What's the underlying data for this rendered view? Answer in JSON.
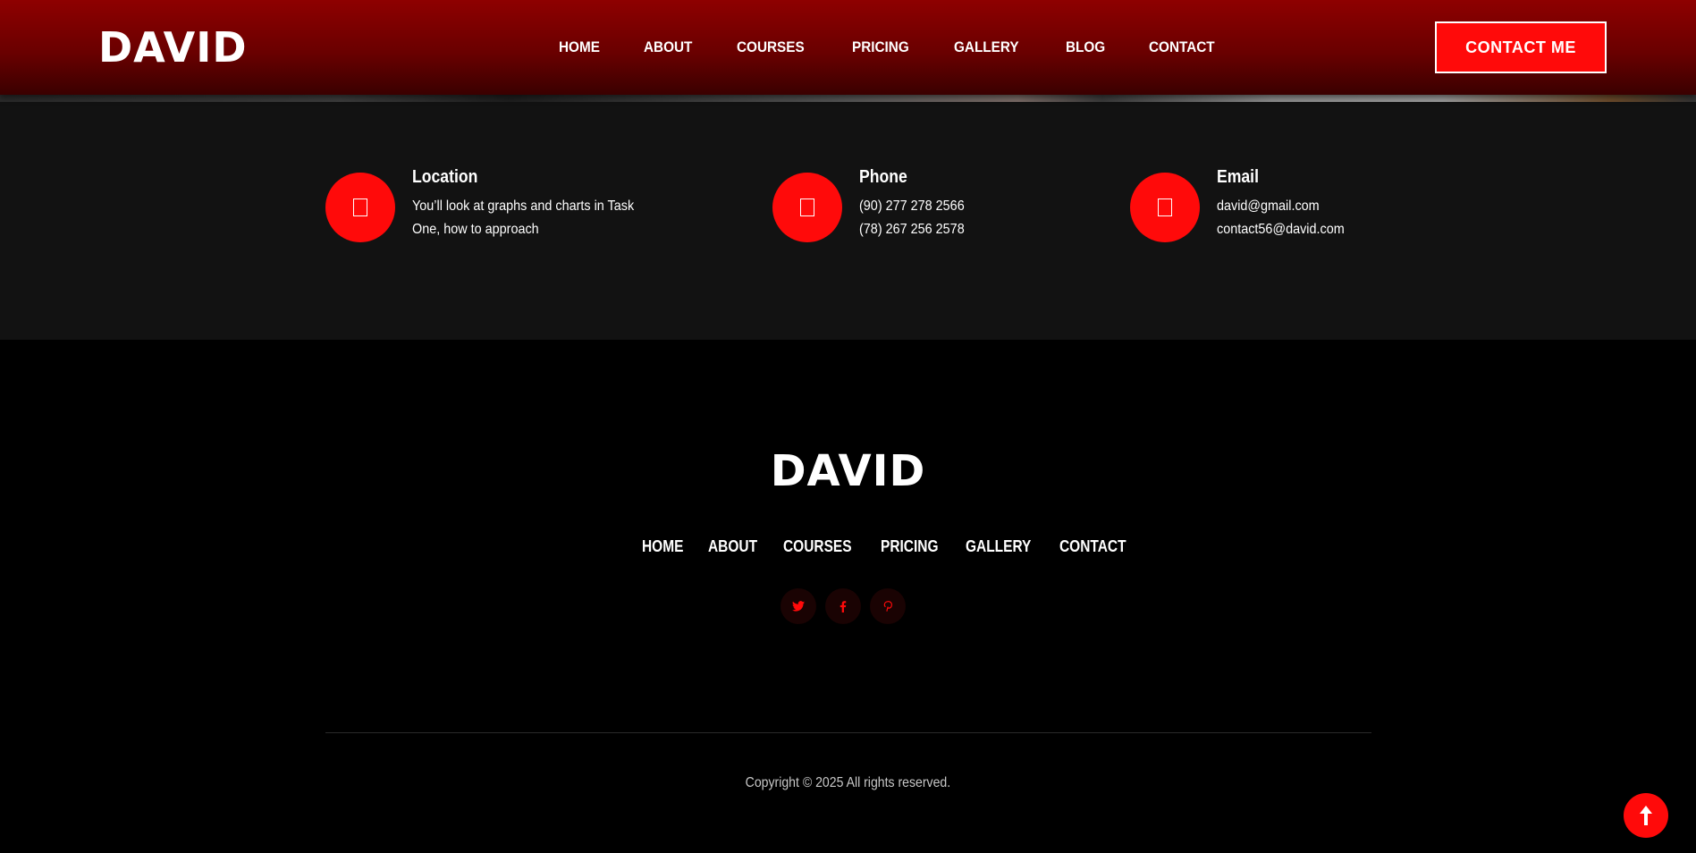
{
  "header": {
    "logo": "DAVID",
    "nav": [
      "HOME",
      "ABOUT",
      "COURSES",
      "PRICING",
      "GALLERY",
      "BLOG",
      "CONTACT"
    ],
    "cta_label": "CONTACT ME"
  },
  "info": {
    "location": {
      "title": "Location",
      "lines": [
        "You’ll look at graphs and charts in Task",
        "One, how to approach"
      ],
      "icon": "map-marker-icon"
    },
    "phone": {
      "title": "Phone",
      "lines": [
        "(90) 277 278 2566",
        "(78) 267 256 2578"
      ],
      "icon": "phone-icon"
    },
    "email": {
      "title": "Email",
      "lines": [
        "david@gmail.com",
        "contact56@david.com"
      ],
      "icon": "envelope-icon"
    }
  },
  "footer": {
    "logo": "DAVID",
    "nav": [
      "HOME",
      "ABOUT",
      "COURSES",
      "PRICING",
      "GALLERY",
      "CONTACT"
    ],
    "social": [
      "twitter-icon",
      "facebook-icon",
      "pinterest-icon"
    ],
    "copyright": "Copyright © 2025 All rights reserved."
  },
  "colors": {
    "accent": "#ff0a0a",
    "header_top": "#8e0000",
    "header_bottom": "#3a0000",
    "info_bg": "#121212",
    "footer_bg": "#000000"
  }
}
